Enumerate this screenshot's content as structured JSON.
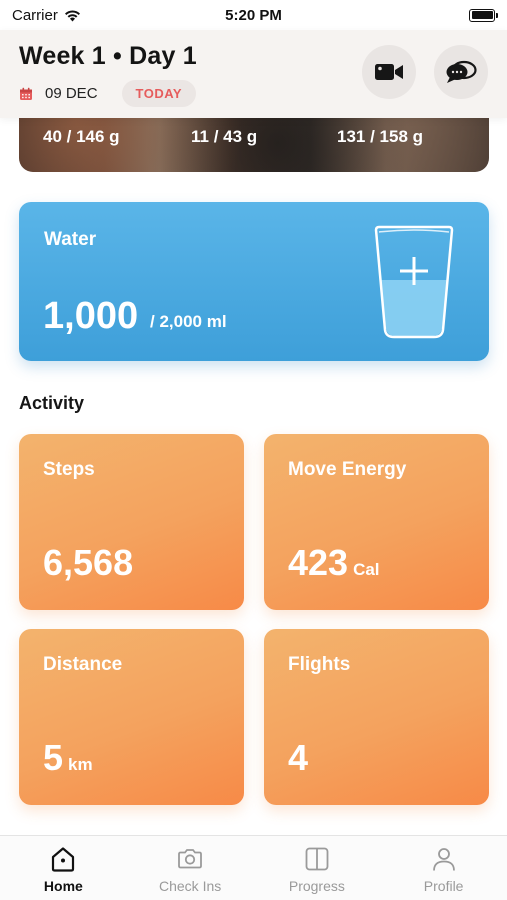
{
  "status_bar": {
    "carrier": "Carrier",
    "time": "5:20 PM"
  },
  "header": {
    "title": "Week 1 • Day 1",
    "date": "09 DEC",
    "today_badge": "TODAY",
    "buttons": [
      "video-call-icon",
      "chat-bubbles-icon"
    ]
  },
  "meal_card": {
    "macros": [
      "40 / 146 g",
      "11 / 43 g",
      "131 / 158 g"
    ]
  },
  "water": {
    "title": "Water",
    "value": "1,000",
    "goal": "/  2,000 ml",
    "icon": "water-glass-plus-icon",
    "fill_fraction": 0.5
  },
  "activity": {
    "title": "Activity",
    "cards": [
      {
        "title": "Steps",
        "value": "6,568",
        "unit": ""
      },
      {
        "title": "Move Energy",
        "value": "423",
        "unit": "Cal"
      },
      {
        "title": "Distance",
        "value": "5",
        "unit": "km"
      },
      {
        "title": "Flights",
        "value": "4",
        "unit": ""
      }
    ]
  },
  "tabs": [
    {
      "label": "Home",
      "icon": "home-icon",
      "active": true
    },
    {
      "label": "Check Ins",
      "icon": "camera-icon",
      "active": false
    },
    {
      "label": "Progress",
      "icon": "progress-icon",
      "active": false
    },
    {
      "label": "Profile",
      "icon": "person-icon",
      "active": false
    }
  ],
  "colors": {
    "water_card": "#4aa8df",
    "activity_card": "#f4a25e",
    "today_badge_text": "#e65c5c",
    "active_tab": "#111111",
    "inactive_tab": "#9a9a9a"
  }
}
